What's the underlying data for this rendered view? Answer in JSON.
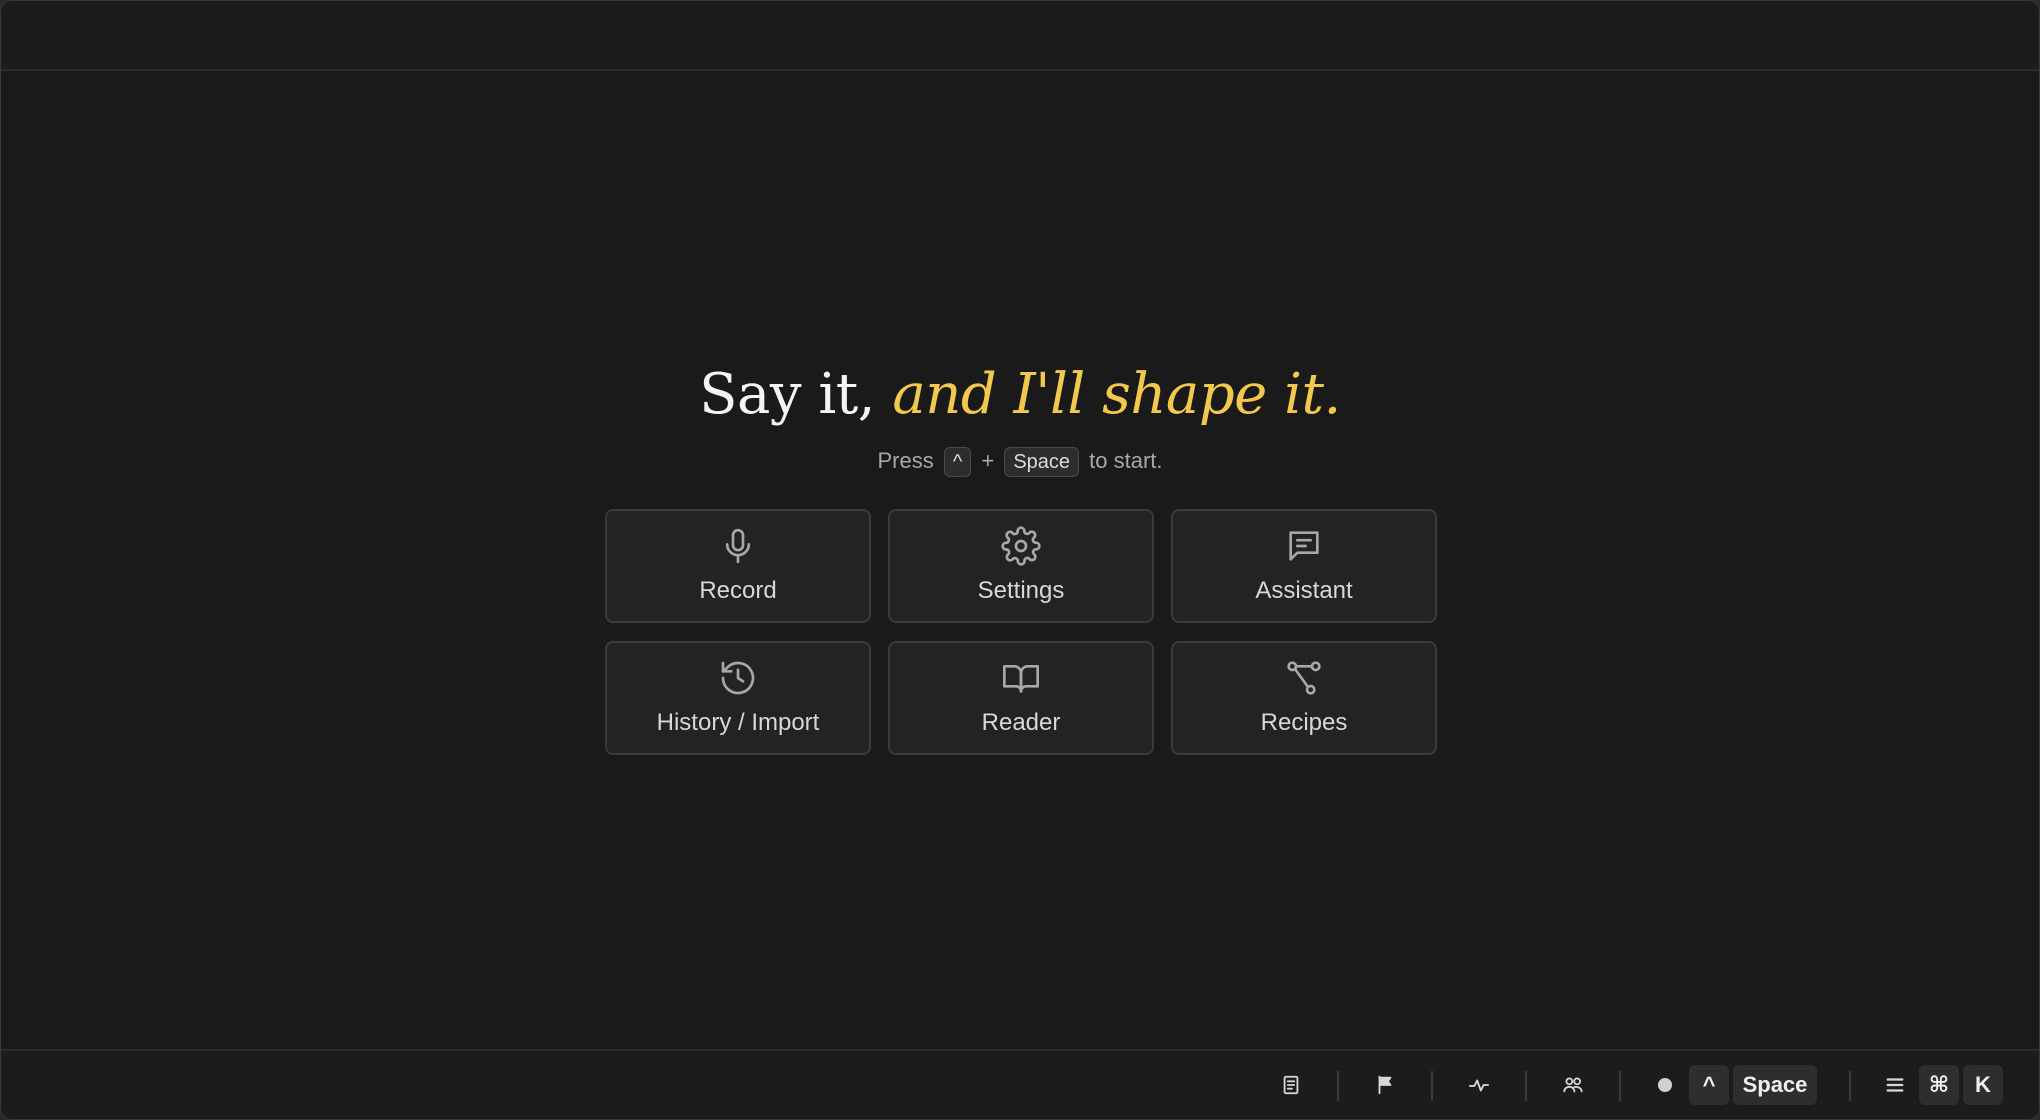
{
  "headline": {
    "plain": "Say it,",
    "accent": "and I'll shape it."
  },
  "hint": {
    "prefix": "Press",
    "key1": "^",
    "plus": "+",
    "key2": "Space",
    "suffix": "to start."
  },
  "tiles": [
    {
      "label": "Record",
      "icon": "microphone-icon"
    },
    {
      "label": "Settings",
      "icon": "gear-icon"
    },
    {
      "label": "Assistant",
      "icon": "chat-icon"
    },
    {
      "label": "History / Import",
      "icon": "history-icon"
    },
    {
      "label": "Reader",
      "icon": "book-icon"
    },
    {
      "label": "Recipes",
      "icon": "workflow-icon"
    }
  ],
  "statusbar": {
    "icons": [
      "document-icon",
      "flag-icon",
      "activity-icon",
      "people-icon",
      "status-dot-icon",
      "menu-icon"
    ],
    "shortcut_record": {
      "key1": "^",
      "key2": "Space"
    },
    "shortcut_palette": {
      "key1": "⌘",
      "key2": "K"
    }
  },
  "colors": {
    "background": "#1a1a1a",
    "accent": "#f2c94c",
    "tile": "#232323",
    "tile_border": "#3a3a3a"
  }
}
